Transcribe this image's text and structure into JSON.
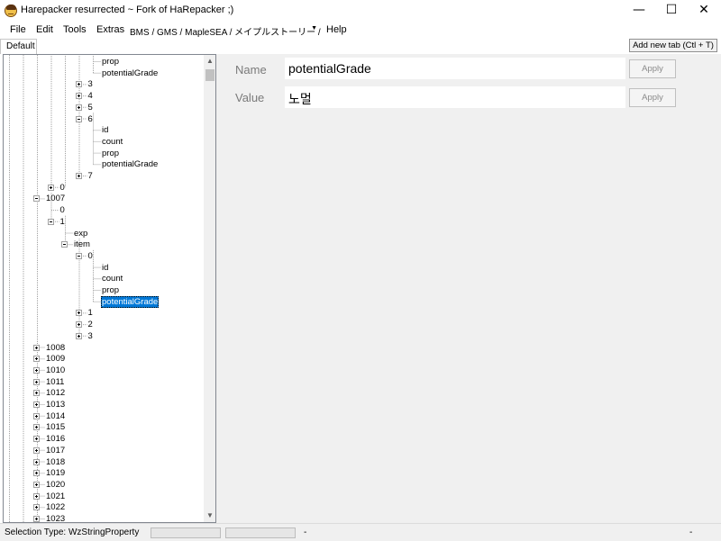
{
  "window": {
    "title": "Harepacker resurrected ~ Fork of HaRepacker ;)",
    "minimize_glyph": "—",
    "maximize_glyph": "☐",
    "close_glyph": "✕",
    "app_icon": "character-face-icon"
  },
  "menu": {
    "items": [
      "File",
      "Edit",
      "Tools",
      "Extras"
    ],
    "region_combo": "BMS / GMS / MapleSEA / メイプルストーリー /",
    "help": "Help"
  },
  "tabs": {
    "default": "Default",
    "add_new": "Add new tab (Ctl + T)"
  },
  "tree": {
    "nodes": [
      {
        "label": "prop",
        "level": 4,
        "expander": "none"
      },
      {
        "label": "potentialGrade",
        "level": 4,
        "expander": "none"
      },
      {
        "label": "3",
        "level": 3,
        "expander": "plus"
      },
      {
        "label": "4",
        "level": 3,
        "expander": "plus"
      },
      {
        "label": "5",
        "level": 3,
        "expander": "plus"
      },
      {
        "label": "6",
        "level": 3,
        "expander": "minus"
      },
      {
        "label": "id",
        "level": 4,
        "expander": "none"
      },
      {
        "label": "count",
        "level": 4,
        "expander": "none"
      },
      {
        "label": "prop",
        "level": 4,
        "expander": "none"
      },
      {
        "label": "potentialGrade",
        "level": 4,
        "expander": "none"
      },
      {
        "label": "7",
        "level": 3,
        "expander": "plus"
      },
      {
        "label": "0",
        "level": 1,
        "expander": "plus"
      },
      {
        "label": "1007",
        "level": 0,
        "expander": "minus"
      },
      {
        "label": "0",
        "level": 1,
        "expander": "none"
      },
      {
        "label": "1",
        "level": 1,
        "expander": "minus"
      },
      {
        "label": "exp",
        "level": 2,
        "expander": "none"
      },
      {
        "label": "item",
        "level": 2,
        "expander": "minus"
      },
      {
        "label": "0",
        "level": 3,
        "expander": "minus"
      },
      {
        "label": "id",
        "level": 4,
        "expander": "none"
      },
      {
        "label": "count",
        "level": 4,
        "expander": "none"
      },
      {
        "label": "prop",
        "level": 4,
        "expander": "none"
      },
      {
        "label": "potentialGrade",
        "level": 4,
        "expander": "none",
        "selected": true
      },
      {
        "label": "1",
        "level": 3,
        "expander": "plus"
      },
      {
        "label": "2",
        "level": 3,
        "expander": "plus"
      },
      {
        "label": "3",
        "level": 3,
        "expander": "plus"
      },
      {
        "label": "1008",
        "level": 0,
        "expander": "plus"
      },
      {
        "label": "1009",
        "level": 0,
        "expander": "plus"
      },
      {
        "label": "1010",
        "level": 0,
        "expander": "plus"
      },
      {
        "label": "1011",
        "level": 0,
        "expander": "plus"
      },
      {
        "label": "1012",
        "level": 0,
        "expander": "plus"
      },
      {
        "label": "1013",
        "level": 0,
        "expander": "plus"
      },
      {
        "label": "1014",
        "level": 0,
        "expander": "plus"
      },
      {
        "label": "1015",
        "level": 0,
        "expander": "plus"
      },
      {
        "label": "1016",
        "level": 0,
        "expander": "plus"
      },
      {
        "label": "1017",
        "level": 0,
        "expander": "plus"
      },
      {
        "label": "1018",
        "level": 0,
        "expander": "plus"
      },
      {
        "label": "1019",
        "level": 0,
        "expander": "plus"
      },
      {
        "label": "1020",
        "level": 0,
        "expander": "plus"
      },
      {
        "label": "1021",
        "level": 0,
        "expander": "plus"
      },
      {
        "label": "1022",
        "level": 0,
        "expander": "plus"
      },
      {
        "label": "1023",
        "level": 0,
        "expander": "plus"
      }
    ]
  },
  "properties": {
    "name_label": "Name",
    "name_value": "potentialGrade",
    "value_label": "Value",
    "value_value": "노멀",
    "apply_label": "Apply"
  },
  "status": {
    "selection": "Selection Type: WzStringProperty",
    "dash1": "-",
    "dash2": "-"
  }
}
